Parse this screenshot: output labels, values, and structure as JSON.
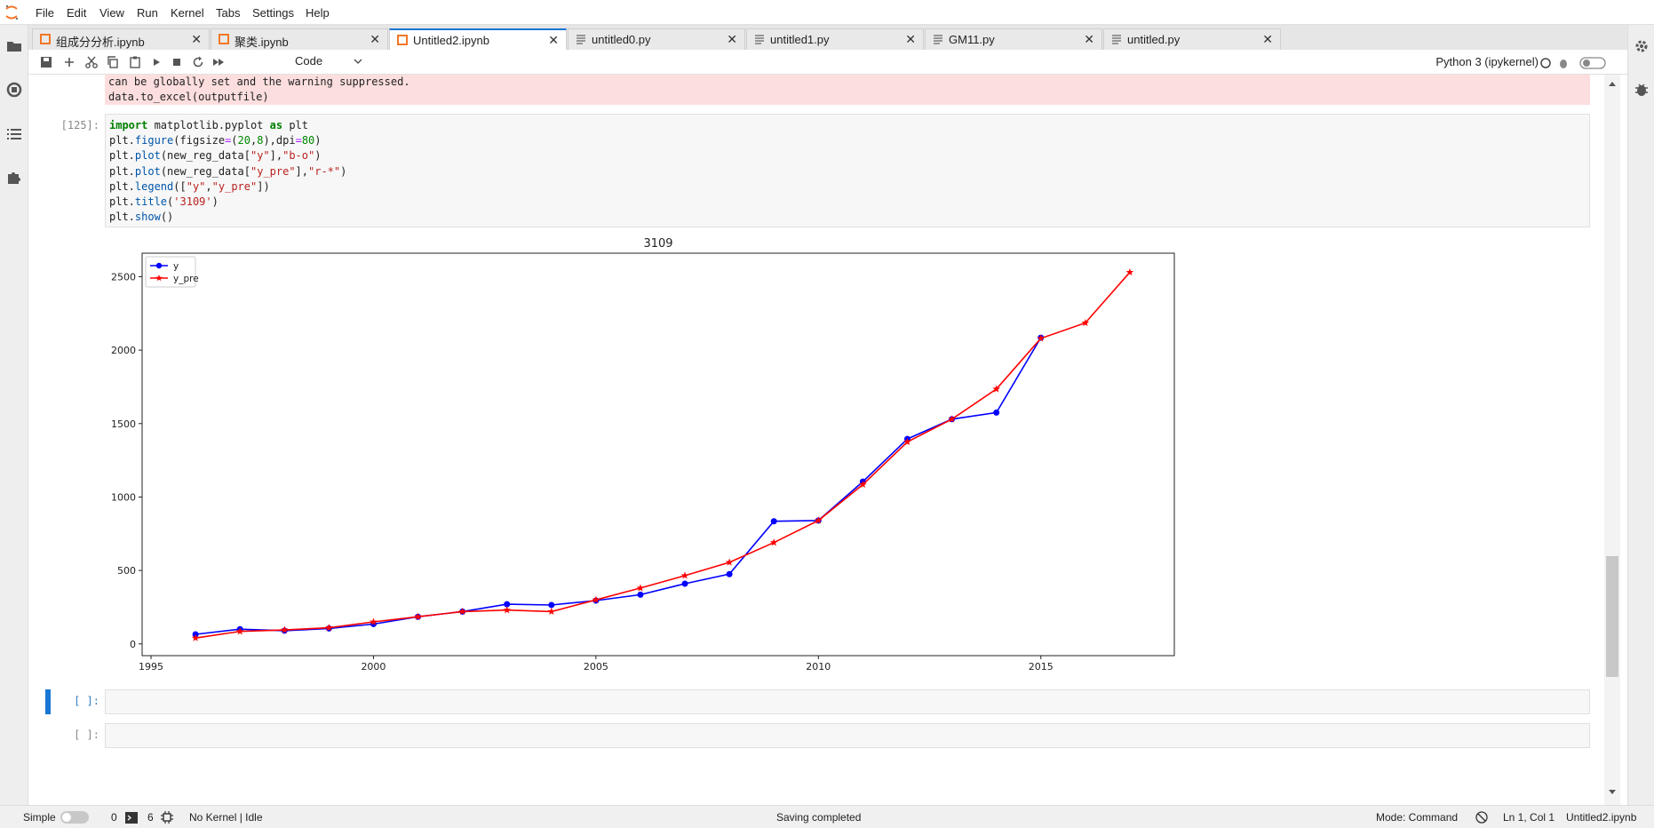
{
  "menu": [
    "File",
    "Edit",
    "View",
    "Run",
    "Kernel",
    "Tabs",
    "Settings",
    "Help"
  ],
  "tabs": [
    {
      "label": "组成分分析.ipynb",
      "type": "notebook"
    },
    {
      "label": "聚类.ipynb",
      "type": "notebook"
    },
    {
      "label": "Untitled2.ipynb",
      "type": "notebook",
      "active": true
    },
    {
      "label": "untitled0.py",
      "type": "file"
    },
    {
      "label": "untitled1.py",
      "type": "file"
    },
    {
      "label": "GM11.py",
      "type": "file"
    },
    {
      "label": "untitled.py",
      "type": "file"
    }
  ],
  "tab_close": "✕",
  "toolbar": {
    "cell_type": "Code",
    "kernel": "Python 3 (ipykernel)"
  },
  "stderr_lines": [
    "can be globally set and the warning suppressed.",
    "  data.to_excel(outputfile)"
  ],
  "cells": {
    "code_cell_prompt": "[125]:",
    "empty_prompt_1": "[ ]:",
    "empty_prompt_2": "[ ]:"
  },
  "code_lines": [
    "import matplotlib.pyplot as plt",
    "plt.figure(figsize=(20,8),dpi=80)",
    "plt.plot(new_reg_data[\"y\"],\"b-o\")",
    "plt.plot(new_reg_data[\"y_pre\"],\"r-*\")",
    "plt.legend([\"y\",\"y_pre\"])",
    "plt.title('3109')",
    "plt.show()"
  ],
  "chart_data": {
    "type": "line",
    "title": "3109",
    "xlabel": "",
    "ylabel": "",
    "xlim": [
      1994.8,
      2018
    ],
    "ylim": [
      -80,
      2660
    ],
    "xticks": [
      1995,
      2000,
      2005,
      2010,
      2015
    ],
    "yticks": [
      0,
      500,
      1000,
      1500,
      2000,
      2500
    ],
    "grid": false,
    "legend_position": "upper-left",
    "series": [
      {
        "name": "y",
        "color": "#0000ff",
        "marker": "circle",
        "x": [
          1996,
          1997,
          1998,
          1999,
          2000,
          2001,
          2002,
          2003,
          2004,
          2005,
          2006,
          2007,
          2008,
          2009,
          2010,
          2011,
          2012,
          2013,
          2014,
          2015
        ],
        "y": [
          65,
          100,
          90,
          105,
          135,
          185,
          220,
          270,
          265,
          295,
          335,
          410,
          475,
          835,
          840,
          1105,
          1395,
          1530,
          1575,
          2085
        ]
      },
      {
        "name": "y_pre",
        "color": "#ff0000",
        "marker": "star",
        "x": [
          1996,
          1997,
          1998,
          1999,
          2000,
          2001,
          2002,
          2003,
          2004,
          2005,
          2006,
          2007,
          2008,
          2009,
          2010,
          2011,
          2012,
          2013,
          2014,
          2015,
          2016,
          2017
        ],
        "y": [
          40,
          85,
          95,
          110,
          150,
          185,
          220,
          230,
          220,
          300,
          380,
          465,
          555,
          690,
          840,
          1085,
          1375,
          1530,
          1735,
          2080,
          2185,
          2530
        ]
      }
    ]
  },
  "status": {
    "mode_label": "Simple",
    "terminals": "0",
    "kernels": "6",
    "kernel_status": "No Kernel | Idle",
    "message": "Saving completed",
    "mode": "Mode: Command",
    "position": "Ln 1, Col 1",
    "filename": "Untitled2.ipynb"
  },
  "colors": {
    "accent": "#1976d2",
    "stderr_bg": "#fddede",
    "series_y": "#0000ff",
    "series_y_pre": "#ff0000"
  }
}
